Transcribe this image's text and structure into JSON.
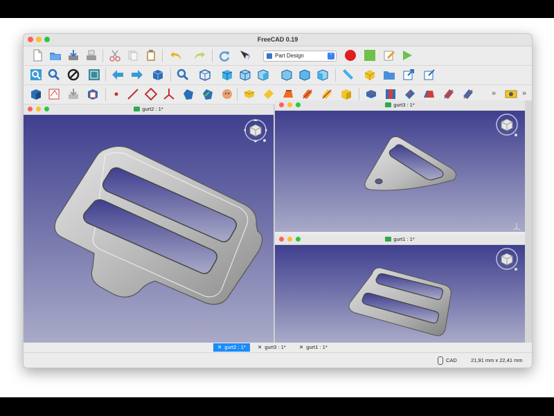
{
  "window": {
    "title": "FreeCAD 0.19"
  },
  "workbench": {
    "selected": "Part Design"
  },
  "viewports": [
    {
      "id": "gurt2",
      "title": "gurt2 : 1*"
    },
    {
      "id": "gurt3",
      "title": "gurt3 : 1*"
    },
    {
      "id": "gurt1",
      "title": "gurt1 : 1*"
    }
  ],
  "tabs": [
    {
      "label": "gurt2 : 1*",
      "active": true
    },
    {
      "label": "gurt3 : 1*",
      "active": false
    },
    {
      "label": "gurt1 : 1*",
      "active": false
    }
  ],
  "statusbar": {
    "nav_style": "CAD",
    "dimensions": "21,91 mm x 22,41 mm"
  },
  "overflow_glyph": "»",
  "colors": {
    "viewport_top": "#3f3f8f",
    "viewport_bottom": "#a9aac8",
    "active_tab": "#1d8cf8"
  },
  "icons": [
    "new-file-icon",
    "open-file-icon",
    "save-icon",
    "save-as-icon",
    "cut-icon",
    "copy-icon",
    "paste-icon",
    "undo-icon",
    "redo-icon",
    "refresh-icon",
    "whats-this-icon",
    "record-macro-icon",
    "stop-macro-icon",
    "edit-macro-icon",
    "run-macro-icon"
  ]
}
